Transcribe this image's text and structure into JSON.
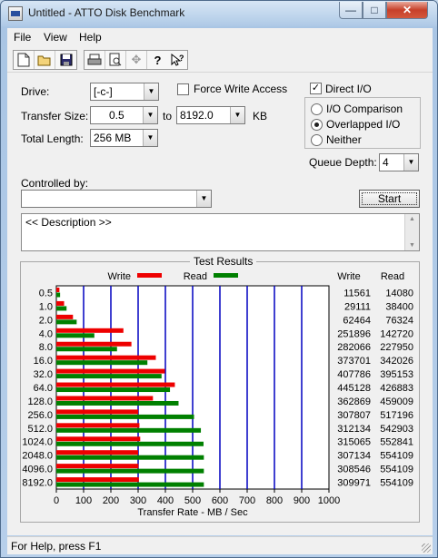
{
  "window": {
    "title": "Untitled - ATTO Disk Benchmark"
  },
  "menu": [
    "File",
    "View",
    "Help"
  ],
  "toolbar": {
    "icons": [
      "new-icon",
      "open-icon",
      "save-icon",
      "print-icon",
      "print-preview-icon",
      "move-icon",
      "help-icon",
      "context-help-icon"
    ]
  },
  "form": {
    "drive_label": "Drive:",
    "drive_value": "[-c-]",
    "transfer_size_label": "Transfer Size:",
    "transfer_from": "0.5",
    "to_label": "to",
    "transfer_to": "8192.0",
    "kb_label": "KB",
    "total_length_label": "Total Length:",
    "total_length_value": "256 MB",
    "force_write_label": "Force Write Access",
    "force_write_checked": false,
    "direct_io_label": "Direct I/O",
    "direct_io_checked": true,
    "io_comparison_label": "I/O Comparison",
    "overlapped_io_label": "Overlapped I/O",
    "neither_label": "Neither",
    "selected_mode": "Overlapped I/O",
    "queue_depth_label": "Queue Depth:",
    "queue_depth_value": "4",
    "controlled_by_label": "Controlled by:",
    "controlled_by_value": "",
    "start_label": "Start",
    "description_text": "<< Description >>"
  },
  "results": {
    "title": "Test Results",
    "write_legend": "Write",
    "read_legend": "Read",
    "write_col": "Write",
    "read_col": "Read"
  },
  "chart_data": {
    "type": "bar",
    "orientation": "horizontal",
    "categories": [
      "0.5",
      "1.0",
      "2.0",
      "4.0",
      "8.0",
      "16.0",
      "32.0",
      "64.0",
      "128.0",
      "256.0",
      "512.0",
      "1024.0",
      "2048.0",
      "4096.0",
      "8192.0"
    ],
    "series": [
      {
        "name": "Write",
        "color": "#ee0000",
        "values": [
          11561,
          29111,
          62464,
          251896,
          282066,
          373701,
          407786,
          445128,
          362869,
          307807,
          312134,
          315065,
          307134,
          308546,
          309971
        ]
      },
      {
        "name": "Read",
        "color": "#008000",
        "values": [
          14080,
          38400,
          76324,
          142720,
          227950,
          342026,
          395153,
          426883,
          459009,
          517196,
          542903,
          552841,
          554109,
          554109,
          554109
        ]
      }
    ],
    "xlabel": "Transfer Rate - MB / Sec",
    "xlim": [
      0,
      1000
    ],
    "xticks": [
      "0",
      "100",
      "200",
      "300",
      "400",
      "500",
      "600",
      "700",
      "800",
      "900",
      "1000"
    ],
    "gridline_color": "#0000c0",
    "legend_position": "top"
  },
  "status": {
    "text": "For Help, press F1"
  }
}
